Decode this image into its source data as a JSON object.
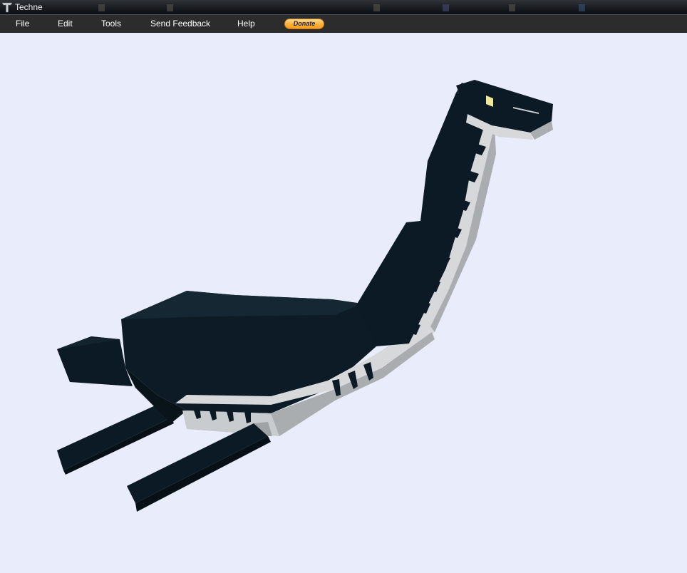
{
  "window": {
    "title": "Techne"
  },
  "menu": {
    "items": [
      {
        "label": "File"
      },
      {
        "label": "Edit"
      },
      {
        "label": "Tools"
      },
      {
        "label": "Send Feedback"
      },
      {
        "label": "Help"
      }
    ],
    "donate_label": "Donate"
  },
  "viewport": {
    "background_color": "#e9ecfa",
    "model_colors": {
      "dark": "#0b1a24",
      "dark_shade": "#081219",
      "belly": "#d6d8da",
      "belly_shade": "#a9adb0",
      "eye": "#efe89a"
    }
  }
}
